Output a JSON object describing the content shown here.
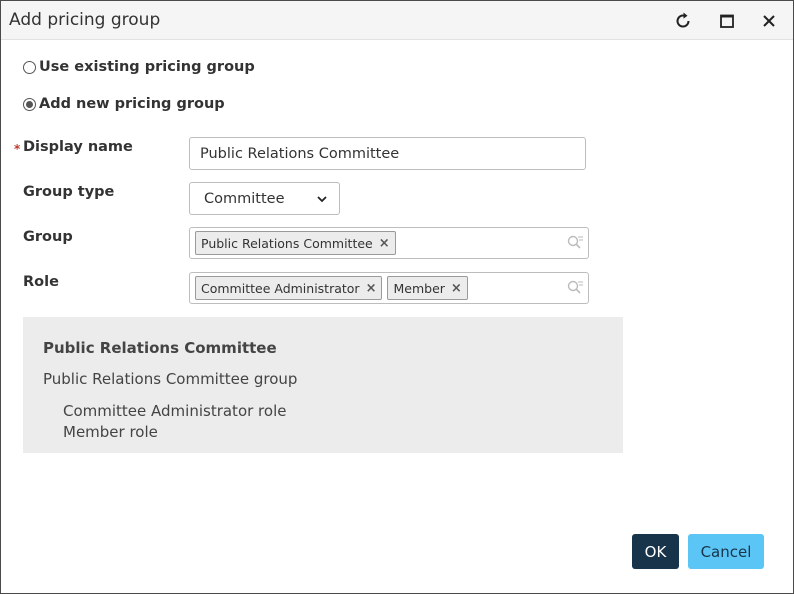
{
  "dialog": {
    "title": "Add pricing group"
  },
  "options": {
    "use_existing_label": "Use existing pricing group",
    "add_new_label": "Add new pricing group",
    "selected": "add_new"
  },
  "form": {
    "display_name_label": "Display name",
    "required_mark": "*",
    "display_name_value": "Public Relations Committee",
    "group_type_label": "Group type",
    "group_type_value": "Committee",
    "group_label": "Group",
    "group_tags": [
      "Public Relations Committee"
    ],
    "role_label": "Role",
    "role_tags": [
      "Committee Administrator",
      "Member"
    ]
  },
  "summary": {
    "title": "Public Relations Committee",
    "group_line": "Public Relations Committee group",
    "role_lines": [
      "Committee Administrator role",
      "Member role"
    ]
  },
  "buttons": {
    "ok_label": "OK",
    "cancel_label": "Cancel"
  },
  "colors": {
    "ok_bg": "#17344a",
    "cancel_bg": "#5bc6f5",
    "required": "#c0392b",
    "summary_bg": "#ececec"
  },
  "icons": {
    "refresh": "refresh-icon",
    "maximize": "maximize-icon",
    "close": "close-icon",
    "search": "search-icon",
    "chevron": "chevron-down-icon",
    "tag_remove": "tag-remove-icon"
  }
}
